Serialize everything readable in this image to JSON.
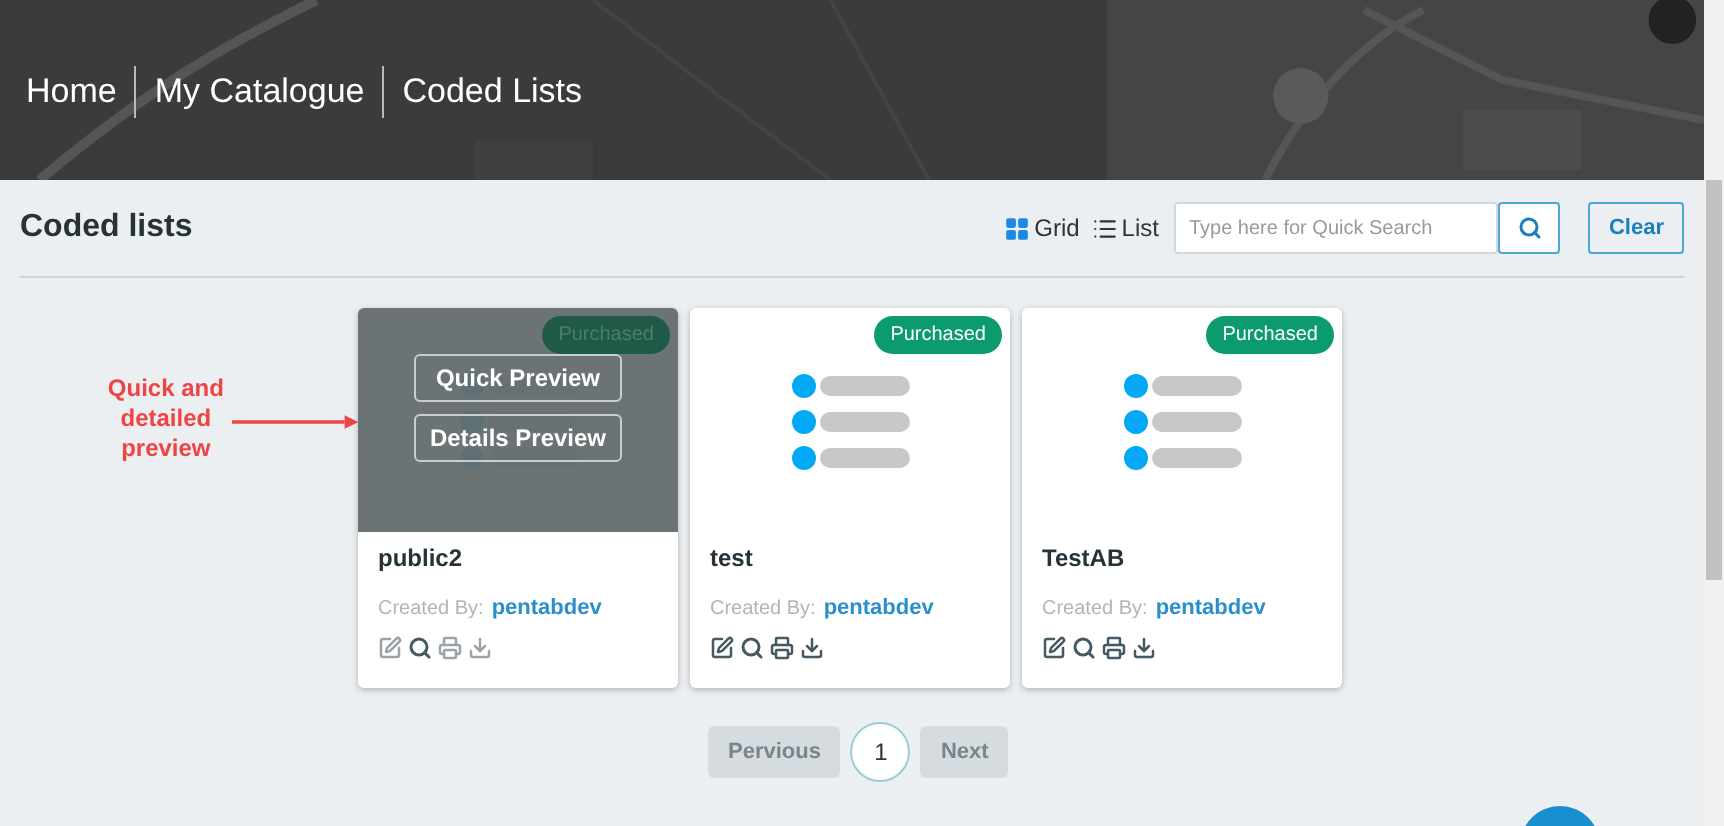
{
  "breadcrumb": [
    "Home",
    "My Catalogue",
    "Coded Lists"
  ],
  "page_title": "Coded lists",
  "view_toggle": [
    {
      "kind": "grid",
      "label": "Grid",
      "selected": true
    },
    {
      "kind": "list",
      "label": "List",
      "selected": false
    }
  ],
  "search": {
    "placeholder": "Type here for Quick Search"
  },
  "clear_button": "Clear",
  "annotation": "Quick and detailed preview",
  "cards": [
    {
      "name": "public2",
      "badge": "Purchased",
      "created_by_label": "Created By:",
      "author": "pentabdev",
      "hovered": true,
      "overlay_buttons": [
        "Quick Preview",
        "Details Preview"
      ]
    },
    {
      "name": "test",
      "badge": "Purchased",
      "created_by_label": "Created By:",
      "author": "pentabdev",
      "hovered": false
    },
    {
      "name": "TestAB",
      "badge": "Purchased",
      "created_by_label": "Created By:",
      "author": "pentabdev",
      "hovered": false
    }
  ],
  "pagination": {
    "previous": "Pervious",
    "pages": [
      {
        "label": "1",
        "selected": true
      }
    ],
    "next": "Next"
  }
}
